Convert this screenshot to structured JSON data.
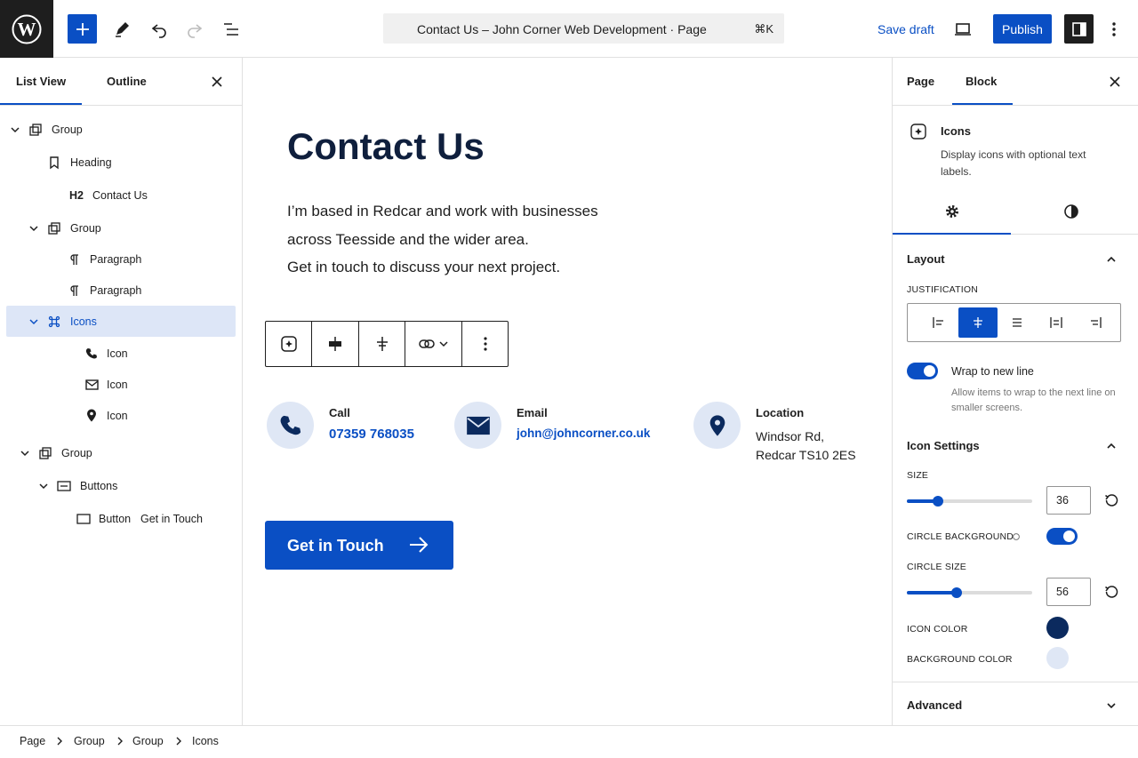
{
  "topbar": {
    "document_title": "Contact Us – John Corner Web Development · Page",
    "shortcut": "⌘K",
    "save_draft": "Save draft",
    "publish": "Publish"
  },
  "list_view": {
    "tabs": [
      "List View",
      "Outline"
    ],
    "items": [
      {
        "label": "Group",
        "icon": "group-icon"
      },
      {
        "label": "Heading",
        "icon": "bookmark-icon"
      },
      {
        "level": "H2",
        "label": "Contact Us"
      },
      {
        "label": "Group",
        "icon": "group-icon"
      },
      {
        "label": "Paragraph",
        "icon": "pilcrow-icon"
      },
      {
        "label": "Paragraph",
        "icon": "pilcrow-icon"
      },
      {
        "label": "Icons",
        "icon": "command-icon"
      },
      {
        "label": "Icon",
        "icon": "phone-icon"
      },
      {
        "label": "Icon",
        "icon": "envelope-icon"
      },
      {
        "label": "Icon",
        "icon": "map-pin-icon"
      },
      {
        "label": "Group",
        "icon": "group-icon"
      },
      {
        "label": "Buttons",
        "icon": "buttons-icon"
      },
      {
        "label": "Button",
        "extra": "Get in Touch",
        "icon": "button-icon"
      }
    ]
  },
  "canvas": {
    "title": "Contact Us",
    "intro_lines": [
      "I’m based in Redcar and work with businesses",
      "across Teesside and the wider area.",
      "Get in touch to discuss your next project."
    ],
    "contacts": [
      {
        "label": "Call",
        "value": "07359 768035",
        "icon": "phone-icon"
      },
      {
        "label": "Email",
        "value": "john@johncorner.co.uk",
        "icon": "envelope-icon"
      },
      {
        "label": "Location",
        "lines": [
          "Windsor Rd,",
          "Redcar TS10 2ES"
        ],
        "icon": "map-pin-icon"
      }
    ],
    "cta": "Get in Touch"
  },
  "sidebar": {
    "tabs": [
      "Page",
      "Block"
    ],
    "block_name": "Icons",
    "block_desc": "Display icons with optional text labels.",
    "layout_title": "Layout",
    "justification_label": "JUSTIFICATION",
    "wrap_label": "Wrap to new line",
    "wrap_help": "Allow items to wrap to the next line on smaller screens.",
    "icon_settings_title": "Icon Settings",
    "size_label": "SIZE",
    "size_value": "36",
    "size_fraction": 0.25,
    "circle_bg_label": "CIRCLE BACKGROUND",
    "circle_size_label": "CIRCLE SIZE",
    "circle_size_value": "56",
    "circle_size_fraction": 0.4,
    "icon_color_label": "ICON COLOR",
    "icon_color": "#0b2a5e",
    "bg_color_label": "BACKGROUND COLOR",
    "bg_color": "#dfe7f5",
    "advanced": "Advanced"
  },
  "breadcrumb": [
    "Page",
    "Group",
    "Group",
    "Icons"
  ],
  "colors": {
    "accent": "#0a4fc4",
    "dark": "#1e1e1e"
  }
}
